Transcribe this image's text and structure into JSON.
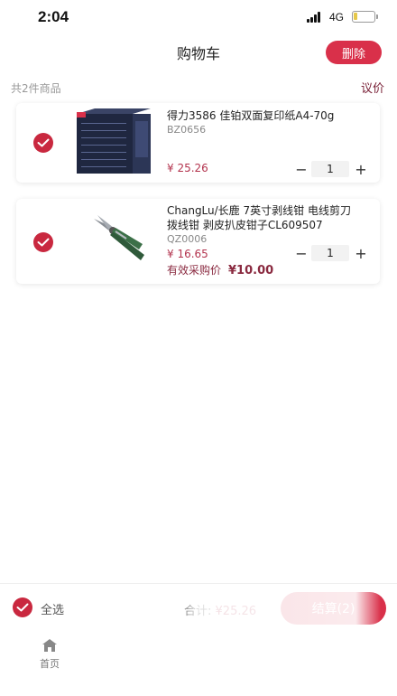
{
  "status": {
    "time": "2:04",
    "network": "4G"
  },
  "header": {
    "title": "购物车",
    "delete_label": "删除"
  },
  "summary": {
    "count_text": "共2件商品",
    "negotiate_label": "议价"
  },
  "items": [
    {
      "title_line1": "得力3586 佳铂双面复印纸A4-70g",
      "title_line2": "",
      "sku": "BZ0656",
      "price": "¥ 25.26",
      "quantity": "1",
      "checked": true,
      "effective_label": "",
      "effective_price": ""
    },
    {
      "title_line1": "ChangLu/长鹿 7英寸剥线钳 电线剪刀",
      "title_line2": "拨线钳 剥皮扒皮钳子CL609507",
      "sku": "QZ0006",
      "price": "¥ 16.65",
      "quantity": "1",
      "checked": true,
      "effective_label": "有效采购价",
      "effective_price": "¥10.00"
    }
  ],
  "stepper": {
    "minus": "−",
    "plus": "+"
  },
  "bottom_bar": {
    "select_all_label": "全选",
    "total_label": "合计:",
    "total_amount": "¥25.26",
    "checkout_label": "结算(2)"
  },
  "tab_bar": {
    "home_label": "首页"
  },
  "colors": {
    "accent": "#d9304a",
    "check": "#c9283f",
    "price": "#b3344e"
  },
  "icons": {
    "check": "check-icon",
    "home": "home-icon"
  }
}
